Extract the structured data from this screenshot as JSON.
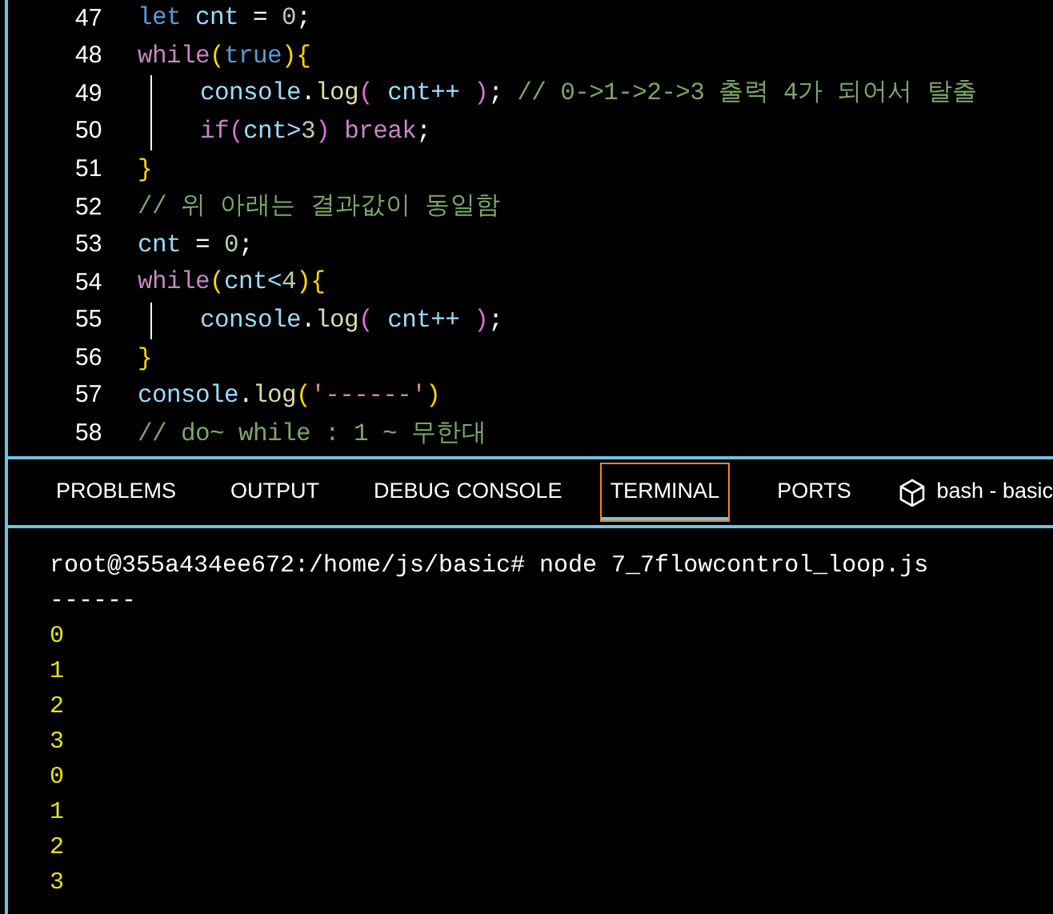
{
  "editor": {
    "lines": [
      {
        "number": "47",
        "guide": false,
        "tokens": [
          {
            "kind": "decl",
            "text": "let"
          },
          {
            "kind": "var",
            "text": " cnt "
          },
          {
            "kind": "op",
            "text": "= "
          },
          {
            "kind": "num",
            "text": "0"
          },
          {
            "kind": "op",
            "text": ";"
          }
        ]
      },
      {
        "number": "48",
        "guide": false,
        "tokens": [
          {
            "kind": "kw",
            "text": "while"
          },
          {
            "kind": "brk",
            "text": "("
          },
          {
            "kind": "decl",
            "text": "true"
          },
          {
            "kind": "brk",
            "text": ")"
          },
          {
            "kind": "brk",
            "text": "{"
          }
        ]
      },
      {
        "number": "49",
        "guide": true,
        "tokens": [
          {
            "kind": "var",
            "text": "console"
          },
          {
            "kind": "op",
            "text": "."
          },
          {
            "kind": "fn",
            "text": "log"
          },
          {
            "kind": "brk2",
            "text": "("
          },
          {
            "kind": "var",
            "text": " cnt++ "
          },
          {
            "kind": "brk2",
            "text": ")"
          },
          {
            "kind": "op",
            "text": "; "
          },
          {
            "kind": "comment",
            "text": "// 0->1->2->3 출력 4가 되어서 탈출"
          }
        ]
      },
      {
        "number": "50",
        "guide": true,
        "tokens": [
          {
            "kind": "kw",
            "text": "if"
          },
          {
            "kind": "brk2",
            "text": "("
          },
          {
            "kind": "var",
            "text": "cnt>"
          },
          {
            "kind": "num",
            "text": "3"
          },
          {
            "kind": "brk2",
            "text": ")"
          },
          {
            "kind": "kw",
            "text": " break"
          },
          {
            "kind": "op",
            "text": ";"
          }
        ]
      },
      {
        "number": "51",
        "guide": false,
        "tokens": [
          {
            "kind": "brk",
            "text": "}"
          }
        ]
      },
      {
        "number": "52",
        "guide": false,
        "tokens": [
          {
            "kind": "comment",
            "text": "// 위 아래는 결과값이 동일함"
          }
        ]
      },
      {
        "number": "53",
        "guide": false,
        "tokens": [
          {
            "kind": "var",
            "text": "cnt "
          },
          {
            "kind": "op",
            "text": "= "
          },
          {
            "kind": "num",
            "text": "0"
          },
          {
            "kind": "op",
            "text": ";"
          }
        ]
      },
      {
        "number": "54",
        "guide": false,
        "tokens": [
          {
            "kind": "kw",
            "text": "while"
          },
          {
            "kind": "brk",
            "text": "("
          },
          {
            "kind": "var",
            "text": "cnt<"
          },
          {
            "kind": "num",
            "text": "4"
          },
          {
            "kind": "brk",
            "text": ")"
          },
          {
            "kind": "brk",
            "text": "{"
          }
        ]
      },
      {
        "number": "55",
        "guide": true,
        "tokens": [
          {
            "kind": "var",
            "text": "console"
          },
          {
            "kind": "op",
            "text": "."
          },
          {
            "kind": "fn",
            "text": "log"
          },
          {
            "kind": "brk2",
            "text": "("
          },
          {
            "kind": "var",
            "text": " cnt++ "
          },
          {
            "kind": "brk2",
            "text": ")"
          },
          {
            "kind": "op",
            "text": ";"
          }
        ]
      },
      {
        "number": "56",
        "guide": false,
        "tokens": [
          {
            "kind": "brk",
            "text": "}"
          }
        ]
      },
      {
        "number": "57",
        "guide": false,
        "tokens": [
          {
            "kind": "var",
            "text": "console"
          },
          {
            "kind": "op",
            "text": "."
          },
          {
            "kind": "fn",
            "text": "log"
          },
          {
            "kind": "brk",
            "text": "("
          },
          {
            "kind": "str",
            "text": "'------'"
          },
          {
            "kind": "brk",
            "text": ")"
          }
        ]
      },
      {
        "number": "58",
        "guide": false,
        "tokens": [
          {
            "kind": "comment",
            "text": "// do~ while : 1 ~ 무한대"
          }
        ]
      }
    ]
  },
  "panel": {
    "tabs": [
      {
        "label": "PROBLEMS",
        "selected": false
      },
      {
        "label": "OUTPUT",
        "selected": false
      },
      {
        "label": "DEBUG CONSOLE",
        "selected": false
      },
      {
        "label": "TERMINAL",
        "selected": true
      },
      {
        "label": "PORTS",
        "selected": false
      }
    ],
    "terminal_name": "bash - basic",
    "terminal": {
      "lines": [
        {
          "kind": "command",
          "text": "root@355a434ee672:/home/js/basic# node 7_7flowcontrol_loop.js"
        },
        {
          "kind": "plain",
          "text": "------"
        },
        {
          "kind": "output",
          "text": "0"
        },
        {
          "kind": "output",
          "text": "1"
        },
        {
          "kind": "output",
          "text": "2"
        },
        {
          "kind": "output",
          "text": "3"
        },
        {
          "kind": "output",
          "text": "0"
        },
        {
          "kind": "output",
          "text": "1"
        },
        {
          "kind": "output",
          "text": "2"
        },
        {
          "kind": "output",
          "text": "3"
        }
      ]
    }
  }
}
